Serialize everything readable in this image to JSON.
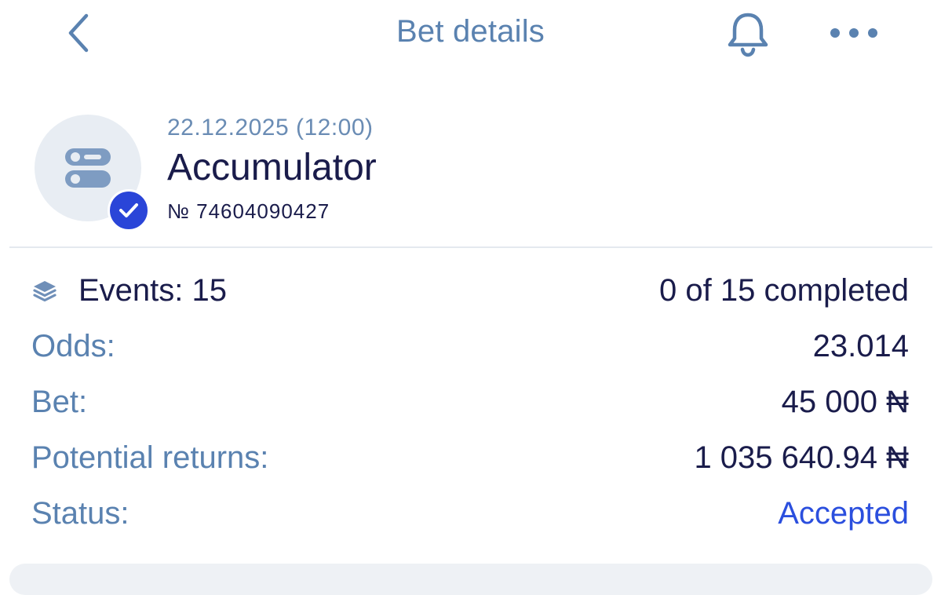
{
  "header": {
    "title": "Bet details",
    "back_icon": "chevron-left-icon",
    "notification_icon": "bell-icon",
    "more_icon": "more-horizontal-icon"
  },
  "bet": {
    "date": "22.12.2025 (12:00)",
    "type": "Accumulator",
    "number": "№ 74604090427",
    "type_icon": "accumulator-icon",
    "status_badge_icon": "checkmark-icon"
  },
  "details": {
    "events_label": "Events: 15",
    "events_icon": "layers-icon",
    "events_progress": "0 of 15 completed",
    "odds_label": "Odds:",
    "odds_value": "23.014",
    "bet_label": "Bet:",
    "bet_value": "45 000 ₦",
    "returns_label": "Potential returns:",
    "returns_value": "1 035 640.94 ₦",
    "status_label": "Status:",
    "status_value": "Accepted"
  },
  "colors": {
    "label": "#5a82b0",
    "value": "#1a1c4b",
    "accent": "#2b4fde",
    "badge": "#2a45d8",
    "avatar_bg": "#e8edf3"
  }
}
